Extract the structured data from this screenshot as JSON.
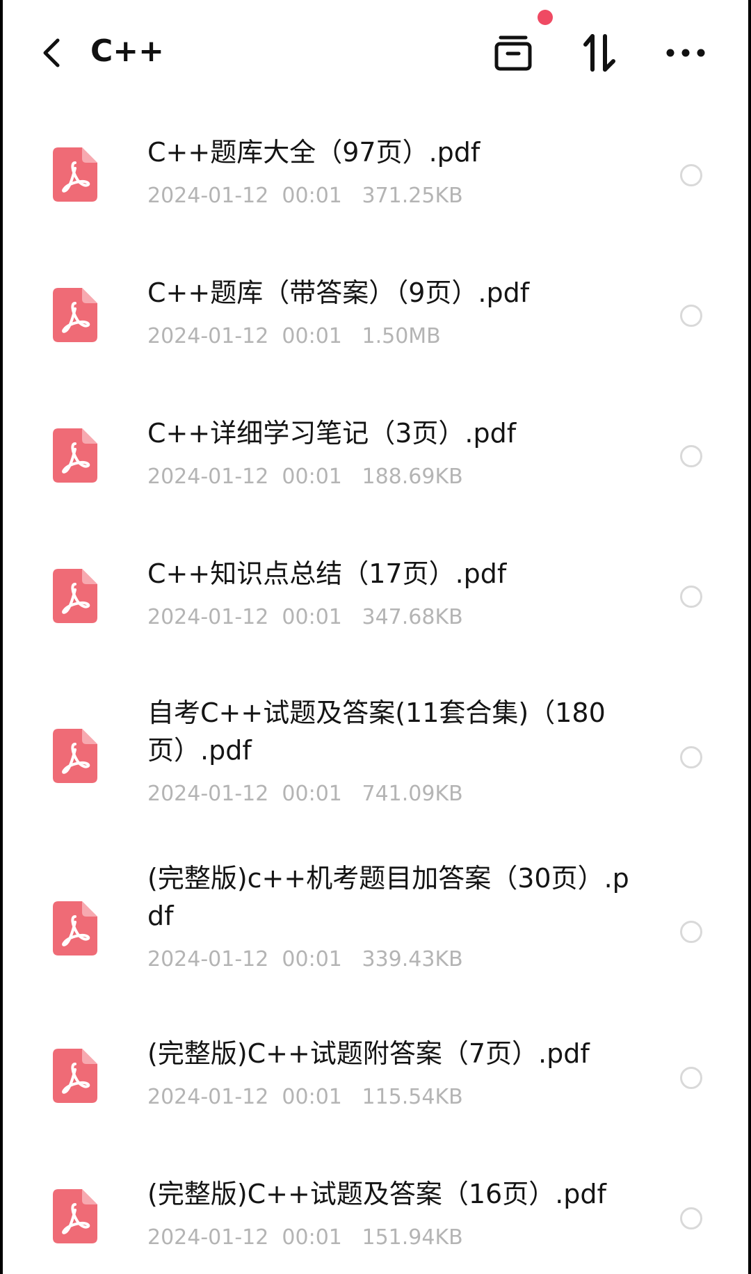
{
  "header": {
    "title": "C++",
    "back_icon": "chevron-left-icon",
    "actions": [
      {
        "name": "archive-icon"
      },
      {
        "name": "sort-icon"
      },
      {
        "name": "more-icon"
      }
    ],
    "notification_dot_color": "#ef4a63"
  },
  "files": [
    {
      "name": "C++题库大全（97页）.pdf",
      "date": "2024-01-12  00:01",
      "size": "371.25KB"
    },
    {
      "name": "C++题库（带答案）（9页）.pdf",
      "date": "2024-01-12  00:01",
      "size": "1.50MB"
    },
    {
      "name": "C++详细学习笔记（3页）.pdf",
      "date": "2024-01-12  00:01",
      "size": "188.69KB"
    },
    {
      "name": "C++知识点总结（17页）.pdf",
      "date": "2024-01-12  00:01",
      "size": "347.68KB"
    },
    {
      "name": "自考C++试题及答案(11套合集)（180页）.pdf",
      "date": "2024-01-12  00:01",
      "size": "741.09KB"
    },
    {
      "name": "(完整版)c++机考题目加答案（30页）.pdf",
      "date": "2024-01-12  00:01",
      "size": "339.43KB"
    },
    {
      "name": "(完整版)C++试题附答案（7页）.pdf",
      "date": "2024-01-12  00:01",
      "size": "115.54KB"
    },
    {
      "name": "(完整版)C++试题及答案（16页）.pdf",
      "date": "2024-01-12  00:01",
      "size": "151.94KB"
    }
  ],
  "file_icon": "pdf-icon",
  "colors": {
    "pdf_icon": "#ef6b76",
    "meta_text": "#b4b4b4"
  }
}
